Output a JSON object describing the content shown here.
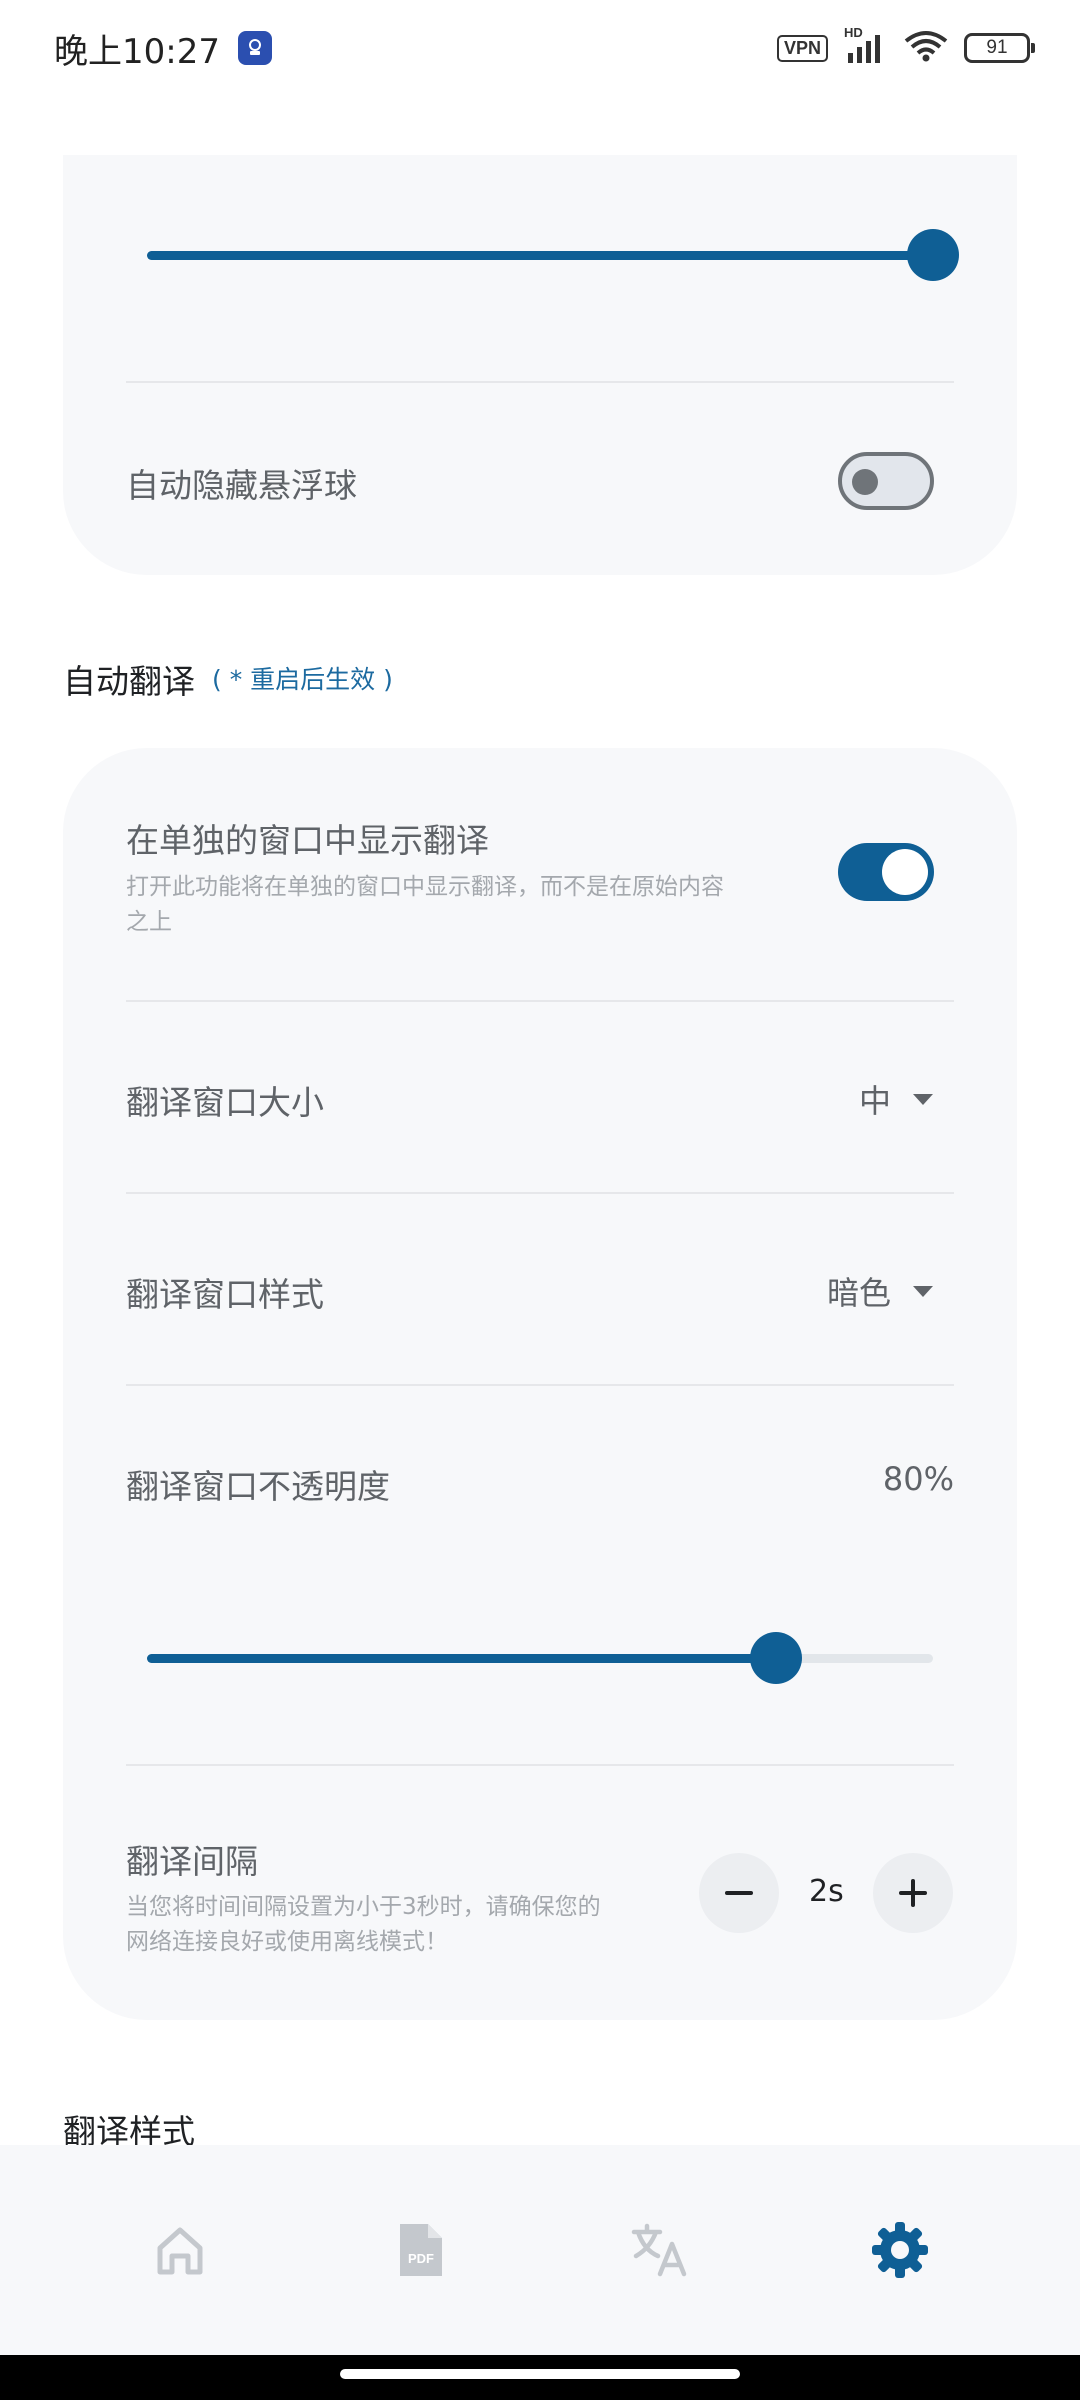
{
  "status_bar": {
    "time": "晚上10:27",
    "vpn": "VPN",
    "network": "HD",
    "battery": "91"
  },
  "floating_ball": {
    "size_slider_percent": 100,
    "auto_hide_label": "自动隐藏悬浮球",
    "auto_hide_enabled": false
  },
  "auto_translate": {
    "section_title": "自动翻译",
    "section_note": "( * 重启后生效 )",
    "separate_window": {
      "title": "在单独的窗口中显示翻译",
      "desc_line1": "打开此功能将在单独的窗口中显示翻译，而不是在原始内容",
      "desc_line2": "之上",
      "enabled": true
    },
    "window_size": {
      "title": "翻译窗口大小",
      "value": "中"
    },
    "window_style": {
      "title": "翻译窗口样式",
      "value": "暗色"
    },
    "opacity": {
      "title": "翻译窗口不透明度",
      "value": "80%",
      "slider_percent": 80
    },
    "interval": {
      "title": "翻译间隔",
      "desc_line1": "当您将时间间隔设置为小于3秒时，请确保您的",
      "desc_line2": "网络连接良好或使用离线模式！",
      "value": "2s"
    }
  },
  "translate_style": {
    "section_title": "翻译样式"
  },
  "bottom_nav": {
    "items": [
      {
        "name": "home",
        "icon": "home-icon",
        "active": false
      },
      {
        "name": "pdf",
        "icon": "pdf-icon",
        "active": false
      },
      {
        "name": "translate",
        "icon": "translate-icon",
        "active": false
      },
      {
        "name": "settings",
        "icon": "gear-icon",
        "active": true
      }
    ]
  },
  "colors": {
    "accent": "#0f5f95",
    "inactive_icon": "#c4c8cd",
    "card_bg": "#f7f8fa"
  }
}
